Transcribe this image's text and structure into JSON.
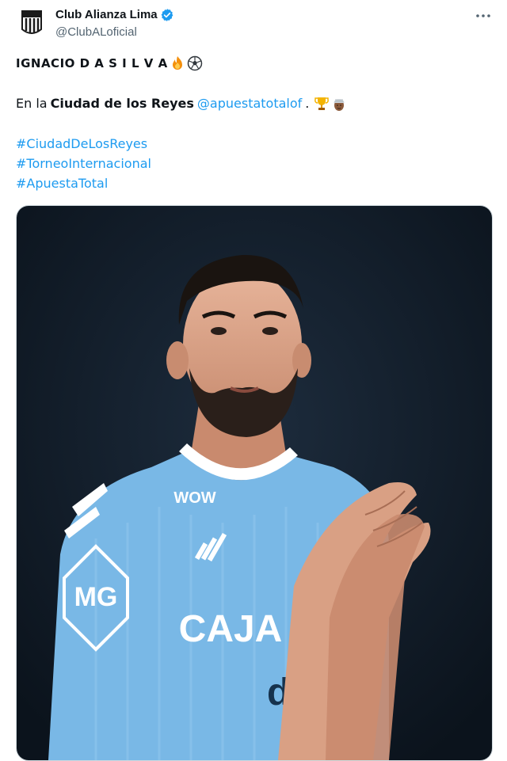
{
  "account": {
    "name": "Club Alianza Lima",
    "handle": "@ClubALoficial",
    "verified": true
  },
  "tweet": {
    "headline": "IGNACIO D A S I L V A",
    "headline_emojis": [
      "fire",
      "soccer-ball"
    ],
    "line2_prefix": "En la",
    "line2_bold": "Ciudad de los Reyes",
    "line2_mention": "@apuestatotalof",
    "line2_suffix": ".",
    "line2_emojis": [
      "trophy",
      "man-with-turban"
    ],
    "hashtags": [
      "#CiudadDeLosReyes",
      "#TorneoInternacional",
      "#ApuestaTotal"
    ]
  },
  "media": {
    "jersey_sponsors": [
      "WOW",
      "MG",
      "CAJA",
      "dob"
    ]
  },
  "colors": {
    "link": "#1d9bf0",
    "verified": "#1d9bf0",
    "photo_bg": "#101a26",
    "jersey": "#79b8e6"
  }
}
